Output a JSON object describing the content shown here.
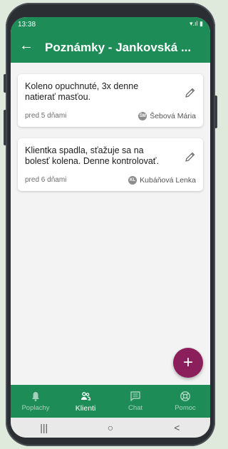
{
  "status_bar": {
    "time": "13:38",
    "icons": "▾.ıl ▮"
  },
  "app_bar": {
    "title": "Poznámky - Jankovská ..."
  },
  "notes": [
    {
      "text": "Koleno opuchnuté, 3x denne natierať masťou.",
      "date": "pred 5 dňami",
      "author": "Šebová Mária",
      "initials": "ŠM"
    },
    {
      "text": "Klientka spadla, sťažuje sa na bolesť kolena. Denne kontrolovať.",
      "date": "pred 6 dňami",
      "author": "Kubáňová Lenka",
      "initials": "KL"
    }
  ],
  "fab": {
    "label": "+"
  },
  "bottom_nav": [
    {
      "label": "Poplachy",
      "icon": "bell-icon",
      "active": false
    },
    {
      "label": "Klienti",
      "icon": "people-icon",
      "active": true
    },
    {
      "label": "Chat",
      "icon": "chat-icon",
      "active": false
    },
    {
      "label": "Pomoc",
      "icon": "lifebuoy-icon",
      "active": false
    }
  ],
  "system_nav": {
    "recents": "|||",
    "home": "○",
    "back": "<"
  },
  "colors": {
    "primary": "#1d8c57",
    "fab": "#8b1f5b",
    "background": "#f3f3f3"
  }
}
